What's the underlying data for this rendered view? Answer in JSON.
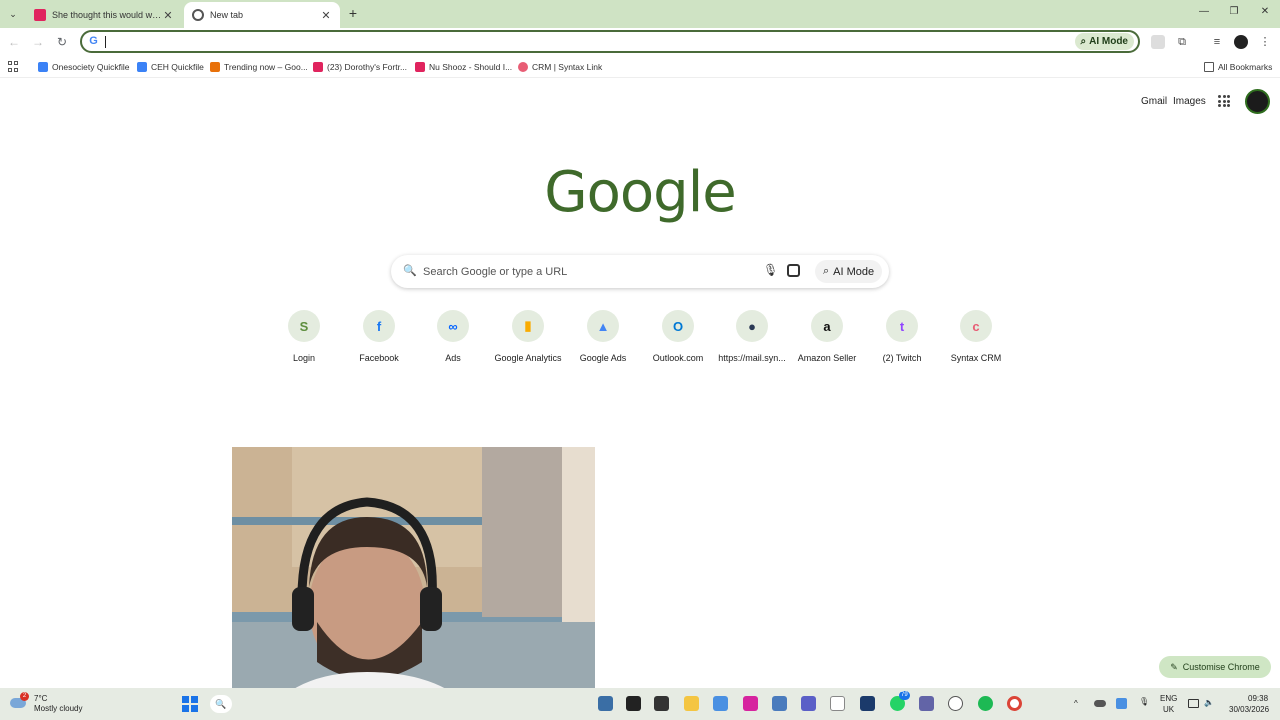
{
  "tabs": [
    {
      "title": "She thought this would work...",
      "active": false
    },
    {
      "title": "New tab",
      "active": true
    }
  ],
  "toolbar": {
    "address_value": "",
    "ai_mode_label": "AI Mode"
  },
  "bookmarks": [
    {
      "label": "Onesociety Quickfile",
      "color": "#3b82f6"
    },
    {
      "label": "CEH Quickfile",
      "color": "#3b82f6"
    },
    {
      "label": "Trending now – Goo...",
      "color": "#e8710a"
    },
    {
      "label": "(23) Dorothy's Fortr...",
      "color": "#e0245e"
    },
    {
      "label": "Nu Shooz - Should I...",
      "color": "#e0245e"
    },
    {
      "label": "CRM | Syntax Link",
      "color": "#e85d75"
    }
  ],
  "all_bookmarks_label": "All Bookmarks",
  "page": {
    "gmail_label": "Gmail",
    "images_label": "Images",
    "logo_text": "Google",
    "search_placeholder": "Search Google or type a URL",
    "ai_mode_label": "AI Mode",
    "customise_label": "Customise Chrome"
  },
  "shortcuts": [
    {
      "label": "Login",
      "glyph": "S",
      "color": "#5e8e3e"
    },
    {
      "label": "Facebook",
      "glyph": "f",
      "color": "#1877f2"
    },
    {
      "label": "Ads",
      "glyph": "∞",
      "color": "#0866ff"
    },
    {
      "label": "Google Analytics",
      "glyph": "▮",
      "color": "#f9ab00"
    },
    {
      "label": "Google Ads",
      "glyph": "▲",
      "color": "#4285f4"
    },
    {
      "label": "Outlook.com",
      "glyph": "O",
      "color": "#0078d4"
    },
    {
      "label": "https://mail.syn...",
      "glyph": "●",
      "color": "#2b3a55"
    },
    {
      "label": "Amazon Seller",
      "glyph": "a",
      "color": "#111111"
    },
    {
      "label": "(2) Twitch",
      "glyph": "t",
      "color": "#9146ff"
    },
    {
      "label": "Syntax CRM",
      "glyph": "c",
      "color": "#e85d75"
    }
  ],
  "taskbar": {
    "weather_temp": "7°C",
    "weather_desc": "Mostly cloudy",
    "weather_badge": "2",
    "language": "ENG",
    "region": "UK",
    "time": "09:38",
    "date": "30/03/2026",
    "whatsapp_badge": "79"
  },
  "colors": {
    "accent": "#3f6a2b",
    "tabstrip": "#cfe3c4"
  }
}
